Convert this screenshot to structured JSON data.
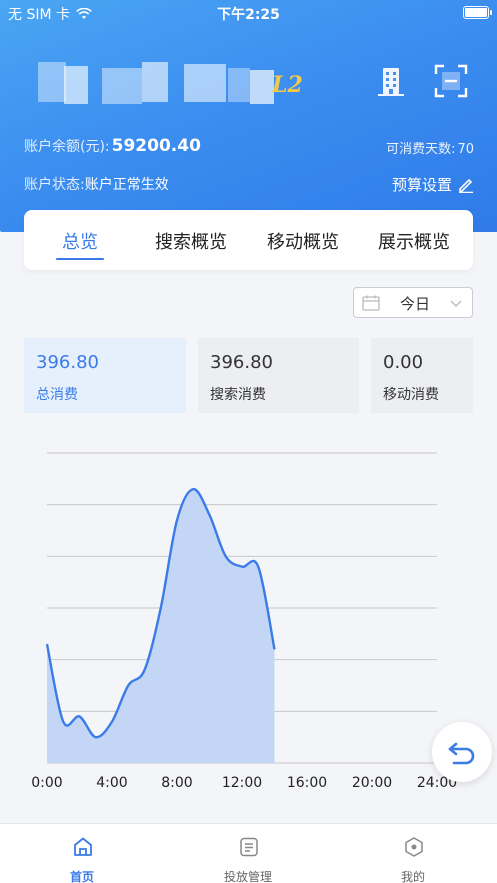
{
  "status_bar": {
    "carrier": "无 SIM 卡",
    "time": "下午2:25"
  },
  "header": {
    "level_badge": "L2",
    "balance_label": "账户余额(元):",
    "balance_value": "59200.40",
    "days_label": "可消费天数:",
    "days_value": "70",
    "state_label": "账户状态:",
    "state_value": "账户正常生效",
    "budget_label": "预算设置"
  },
  "tabs": [
    "总览",
    "搜索概览",
    "移动概览",
    "展示概览"
  ],
  "date_select": {
    "value": "今日"
  },
  "stats": [
    {
      "value": "396.80",
      "label": "总消费"
    },
    {
      "value": "396.80",
      "label": "搜索消费"
    },
    {
      "value": "0.00",
      "label": "移动消费"
    }
  ],
  "chart_data": {
    "type": "area",
    "x_ticks": [
      "0:00",
      "4:00",
      "8:00",
      "12:00",
      "16:00",
      "20:00",
      "24:00"
    ],
    "xlim": [
      0,
      24
    ],
    "ylim": [
      0,
      6
    ],
    "grid": true,
    "color": "#3b7be8",
    "x": [
      0,
      1,
      2,
      3,
      4,
      5,
      6,
      7,
      8,
      9,
      10,
      11,
      12,
      13,
      14
    ],
    "y": [
      2.3,
      0.8,
      0.9,
      0.5,
      0.8,
      1.5,
      1.8,
      3.0,
      4.7,
      5.3,
      4.8,
      4.0,
      3.8,
      3.8,
      2.2
    ],
    "title": "",
    "xlabel": "",
    "ylabel": ""
  },
  "bottom_nav": [
    {
      "label": "首页",
      "icon": "home-icon",
      "active": true
    },
    {
      "label": "投放管理",
      "icon": "list-icon",
      "active": false
    },
    {
      "label": "我的",
      "icon": "profile-icon",
      "active": false
    }
  ],
  "colors": {
    "accent": "#3b7be8",
    "header_gradient_start": "#4aa6f3",
    "header_gradient_end": "#2f7ae8",
    "level_badge": "#f1c94a"
  }
}
